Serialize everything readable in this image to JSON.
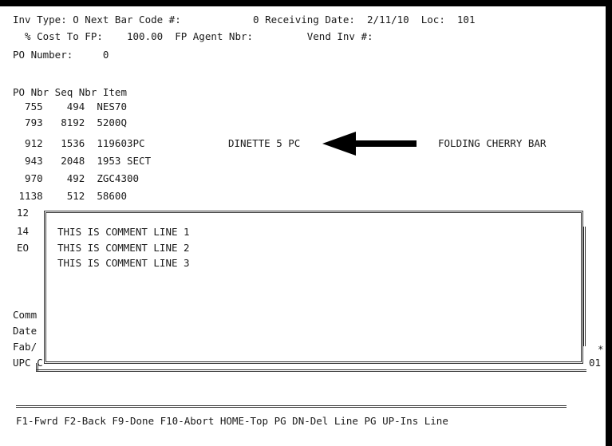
{
  "header": {
    "line1": "Inv Type: O Next Bar Code #:            0 Receiving Date:  2/11/10  Loc:  101",
    "line2": "  % Cost To FP:    100.00  FP Agent Nbr:         Vend Inv #:",
    "line3": "PO Number:     0"
  },
  "table": {
    "header": "PO Nbr Seq Nbr Item",
    "rows": [
      "  755    494  NES70",
      "  793   8192  5200Q",
      "  912   1536  119603PC",
      "  943   2048  1953 SECT",
      "  970    492  ZGC4300",
      " 1138    512  58600"
    ],
    "row912_desc": "DINETTE 5 PC",
    "row912_right": "FOLDING CHERRY BAR",
    "partial_rows": [
      "12",
      "14",
      "EO"
    ]
  },
  "left_labels": [
    "Comm",
    "Date",
    "Fab/",
    "UPC C"
  ],
  "right_fragments": [
    "*",
    "01"
  ],
  "comment_box": {
    "lines": [
      "THIS IS COMMENT LINE 1",
      "THIS IS COMMENT LINE 2",
      "THIS IS COMMENT LINE 3"
    ]
  },
  "footer": "F1-Fwrd F2-Back F9-Done F10-Abort HOME-Top PG DN-Del Line PG UP-Ins Line",
  "colors": {
    "background": "#ffffff",
    "text": "#1a1a1a",
    "border": "#333333",
    "arrow": "#000000"
  }
}
